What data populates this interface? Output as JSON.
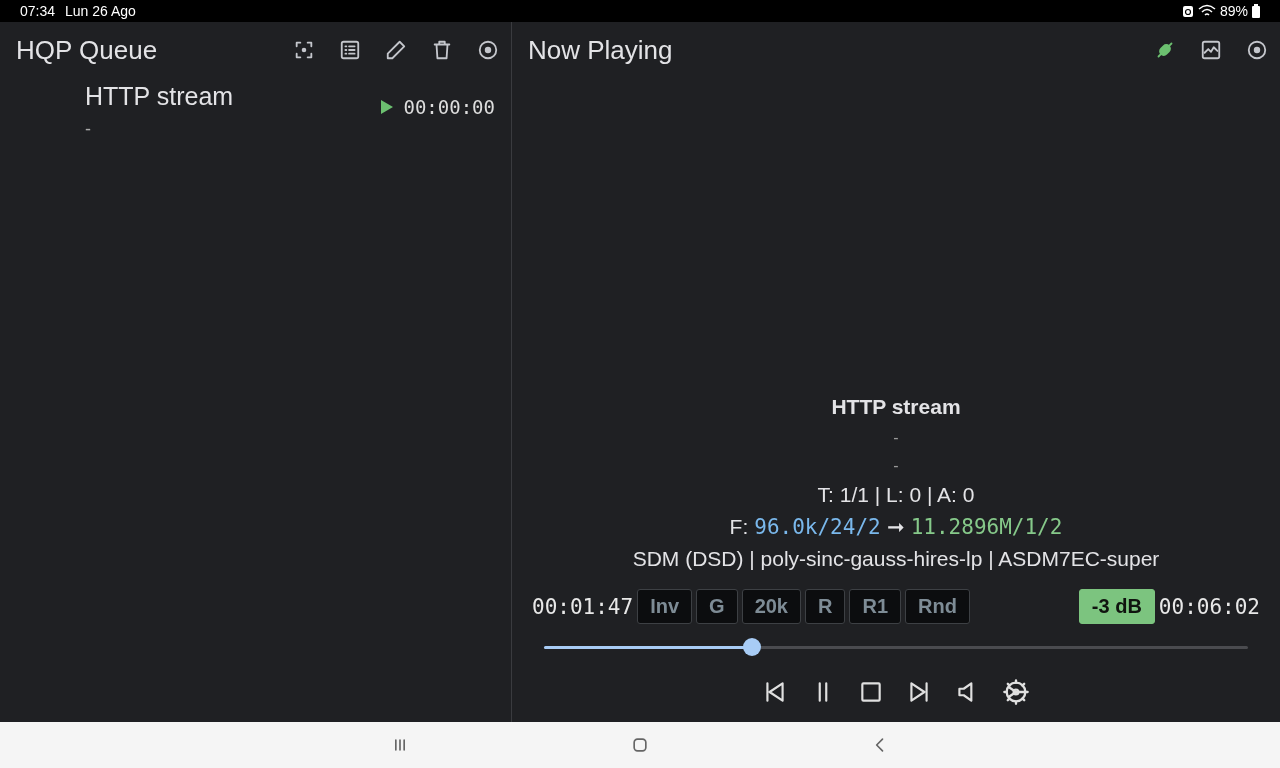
{
  "status_bar": {
    "time": "07:34",
    "date": "Lun 26 Ago",
    "battery": "89%"
  },
  "queue": {
    "title": "HQP Queue",
    "items": [
      {
        "title": "HTTP stream",
        "subtitle": "-",
        "time": "00:00:00",
        "playing": true
      }
    ]
  },
  "now_playing": {
    "title": "Now Playing",
    "connected": true,
    "track": "HTTP stream",
    "artist": "-",
    "album": "-",
    "counters": "T: 1/1 | L: 0 | A: 0",
    "format_label": "F:",
    "format_in": "96.0k/24/2",
    "format_arrow": "➞",
    "format_out": "11.2896M/1/2",
    "filters": "SDM (DSD) | poly-sinc-gauss-hires-lp | ASDM7EC-super",
    "elapsed": "00:01:47",
    "total": "00:06:02",
    "chips": [
      {
        "label": "Inv",
        "on": false
      },
      {
        "label": "G",
        "on": false
      },
      {
        "label": "20k",
        "on": false
      },
      {
        "label": "R",
        "on": false
      },
      {
        "label": "R1",
        "on": false
      },
      {
        "label": "Rnd",
        "on": false
      }
    ],
    "volume": {
      "label": "-3 dB",
      "on": true
    },
    "progress": {
      "level": 0.295
    }
  }
}
